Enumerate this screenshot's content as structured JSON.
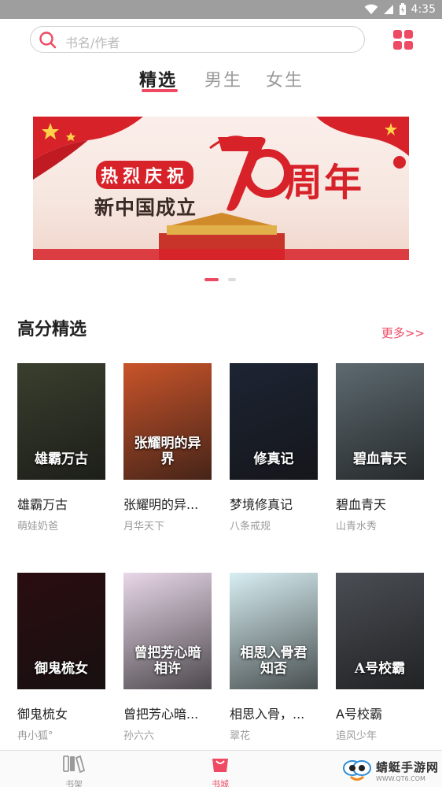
{
  "status_bar": {
    "time": "4:35"
  },
  "search": {
    "placeholder": "书名/作者"
  },
  "tabs": [
    {
      "label": "精选",
      "active": true
    },
    {
      "label": "男生",
      "active": false
    },
    {
      "label": "女生",
      "active": false
    }
  ],
  "banner": {
    "line1": "热烈庆祝",
    "line2": "新中国成立",
    "big_number": "70",
    "suffix": "周年"
  },
  "section": {
    "title": "高分精选",
    "more": "更多>>"
  },
  "books": [
    {
      "title": "雄霸万古",
      "author": "萌娃奶爸",
      "cover_text": "雄霸万古",
      "cover_color": "#3a3f2e"
    },
    {
      "title": "张耀明的异...",
      "author": "月华天下",
      "cover_text": "张耀明的异界",
      "cover_color": "#c9542a"
    },
    {
      "title": "梦境修真记",
      "author": "八条戒规",
      "cover_text": "修真记",
      "cover_color": "#1d2433"
    },
    {
      "title": "碧血青天",
      "author": "山青水秀",
      "cover_text": "碧血青天",
      "cover_color": "#5d6a70"
    },
    {
      "title": "御鬼梳女",
      "author": "冉小狐°",
      "cover_text": "御鬼梳女",
      "cover_color": "#2a0d10"
    },
    {
      "title": "曾把芳心暗...",
      "author": "孙六六",
      "cover_text": "曾把芳心暗相许",
      "cover_color": "#e8d7e8"
    },
    {
      "title": "相思入骨，...",
      "author": "翠花",
      "cover_text": "相思入骨君知否",
      "cover_color": "#d7eef2"
    },
    {
      "title": "A号校霸",
      "author": "追风少年",
      "cover_text": "A号校霸",
      "cover_color": "#4a4e54"
    }
  ],
  "bottom_nav": [
    {
      "label": "书架",
      "active": false
    },
    {
      "label": "书城",
      "active": true
    }
  ],
  "watermark": {
    "text": "蜻蜓手游网",
    "url": "WWW.QT6.COM"
  },
  "colors": {
    "accent": "#ee4a64",
    "status_bar": "#9e9e9e"
  }
}
